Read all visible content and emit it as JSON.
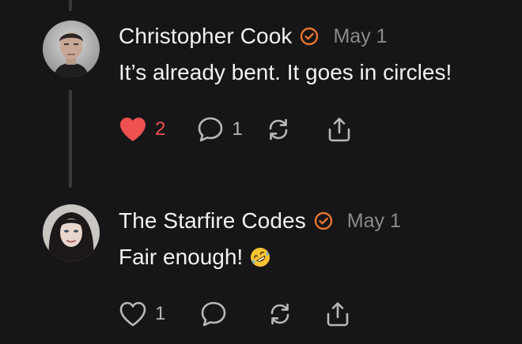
{
  "comments": [
    {
      "author": "Christopher Cook",
      "verified_icon": "verified-badge-icon",
      "date": "May 1",
      "text": "It’s already bent. It goes in circles!",
      "emoji": "",
      "actions": {
        "like_count": "2",
        "liked": true,
        "comment_count": "1",
        "restack_count": "",
        "share_label": ""
      }
    },
    {
      "author": "The Starfire Codes",
      "verified_icon": "verified-badge-icon",
      "date": "May 1",
      "text": "Fair enough!",
      "emoji": "rolling-on-floor-laughing",
      "actions": {
        "like_count": "1",
        "liked": false,
        "comment_count": "",
        "restack_count": "",
        "share_label": ""
      }
    }
  ],
  "colors": {
    "background": "#161618",
    "accent_orange": "#e8762d",
    "like_red": "#ef5050",
    "muted_text": "#8a8a8e",
    "thread_line": "#3a3a3c"
  }
}
